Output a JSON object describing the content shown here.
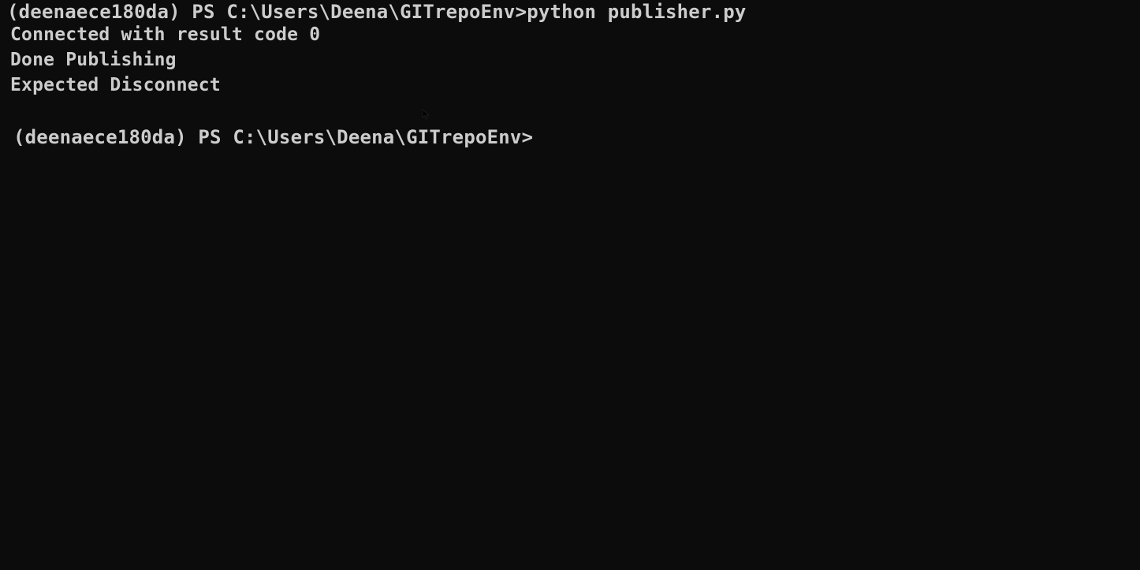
{
  "terminal": {
    "background": "#0c0c0c",
    "foreground": "#cccccc",
    "lines": [
      "(deenaece180da) PS C:\\Users\\Deena\\GITrepoEnv>python publisher.py",
      "Connected with result code 0",
      "Done Publishing",
      "Expected Disconnect",
      "(deenaece180da) PS C:\\Users\\Deena\\GITrepoEnv>"
    ]
  },
  "icons": {
    "mouse_cursor": "mouse-pointer-icon"
  }
}
